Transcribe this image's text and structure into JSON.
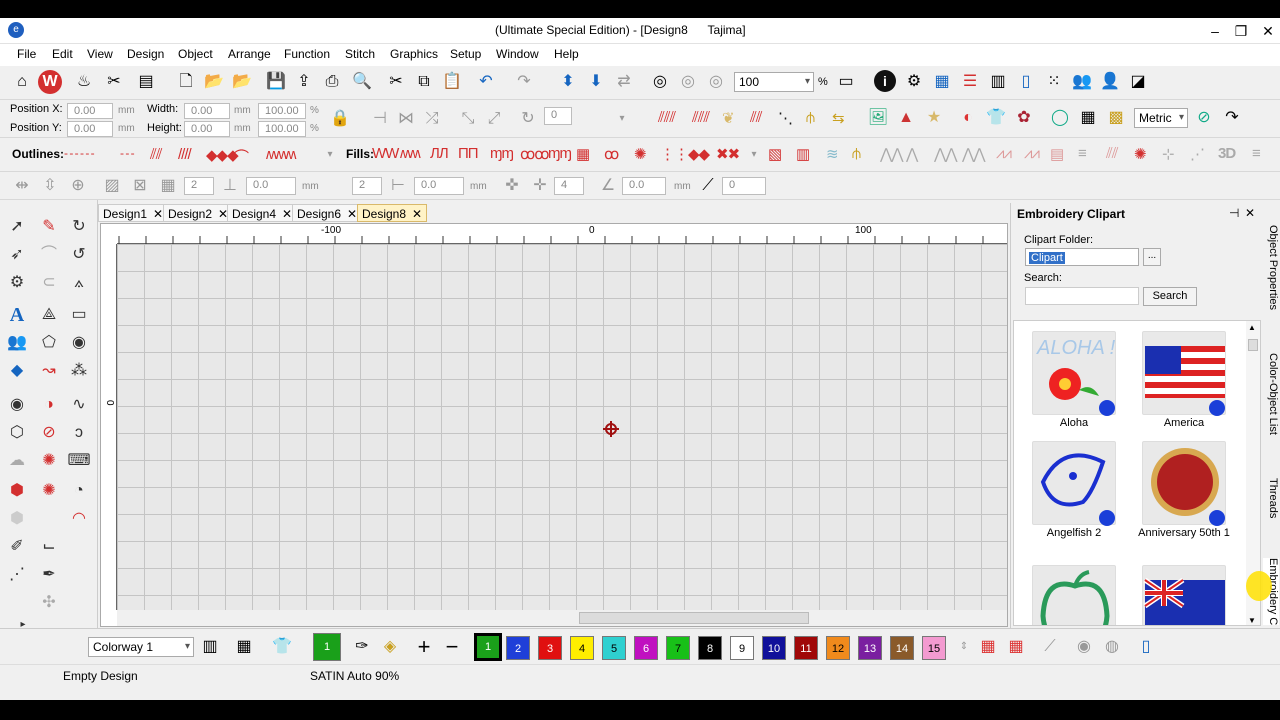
{
  "window": {
    "title": "(Ultimate Special Edition) - [Design8      Tajima]"
  },
  "menu": [
    "File",
    "Edit",
    "View",
    "Design",
    "Object",
    "Arrange",
    "Function",
    "Stitch",
    "Graphics",
    "Setup",
    "Window",
    "Help"
  ],
  "toolbar": {
    "zoom_value": "100",
    "zoom_unit": "%"
  },
  "position": {
    "x_label": "Position X:",
    "y_label": "Position Y:",
    "x_value": "0.00",
    "y_value": "0.00",
    "unit": "mm",
    "width_label": "Width:",
    "height_label": "Height:",
    "width_value": "0.00",
    "height_value": "0.00",
    "width_pct": "100.00",
    "height_pct": "100.00",
    "pct": "%",
    "rotate_value": "0",
    "units_select": "Metric"
  },
  "outlines_label": "Outlines:",
  "fills_label": "Fills:",
  "tb4": {
    "v1": "2",
    "v2": "0.0",
    "u": "mm",
    "v3": "2",
    "v4": "0.0",
    "v5": "4",
    "v6": "0.0",
    "v7": "0"
  },
  "tabs": [
    "Design1",
    "Design2",
    "Design4",
    "Design6",
    "Design8"
  ],
  "active_tab": "Design8",
  "ruler": {
    "h_left": "-100",
    "h_zero": "0",
    "h_right": "100",
    "v_zero": "0"
  },
  "clipart": {
    "title": "Embroidery Clipart",
    "folder_label": "Clipart Folder:",
    "folder_value": "Clipart",
    "browse_label": "...",
    "search_label": "Search:",
    "search_value": "",
    "search_button": "Search",
    "items": [
      "Aloha",
      "America",
      "Angelfish 2",
      "Anniversary 50th 1"
    ]
  },
  "side_tabs": [
    "Object Properties",
    "Color-Object List",
    "Threads",
    "Embroidery C"
  ],
  "colorway": "Colorway 1",
  "current_color": "1",
  "swatches": [
    {
      "n": "1",
      "c": "#ffffff",
      "t": "#000"
    },
    {
      "n": "2",
      "c": "#1f3fd8",
      "t": "#fff"
    },
    {
      "n": "3",
      "c": "#e01010",
      "t": "#fff"
    },
    {
      "n": "4",
      "c": "#ffee00",
      "t": "#000"
    },
    {
      "n": "5",
      "c": "#2fd0d0",
      "t": "#000"
    },
    {
      "n": "6",
      "c": "#c010c0",
      "t": "#fff"
    },
    {
      "n": "7",
      "c": "#18c018",
      "t": "#000"
    },
    {
      "n": "8",
      "c": "#000000",
      "t": "#fff"
    },
    {
      "n": "9",
      "c": "#ffffff",
      "t": "#000"
    },
    {
      "n": "10",
      "c": "#10109a",
      "t": "#fff"
    },
    {
      "n": "11",
      "c": "#a00808",
      "t": "#fff"
    },
    {
      "n": "12",
      "c": "#f08a1c",
      "t": "#000"
    },
    {
      "n": "13",
      "c": "#7a1fa0",
      "t": "#fff"
    },
    {
      "n": "14",
      "c": "#8a5a2a",
      "t": "#fff"
    },
    {
      "n": "15",
      "c": "#f39ad0",
      "t": "#000"
    }
  ],
  "status": {
    "left": "Empty Design",
    "mid": "SATIN Auto 90%"
  }
}
